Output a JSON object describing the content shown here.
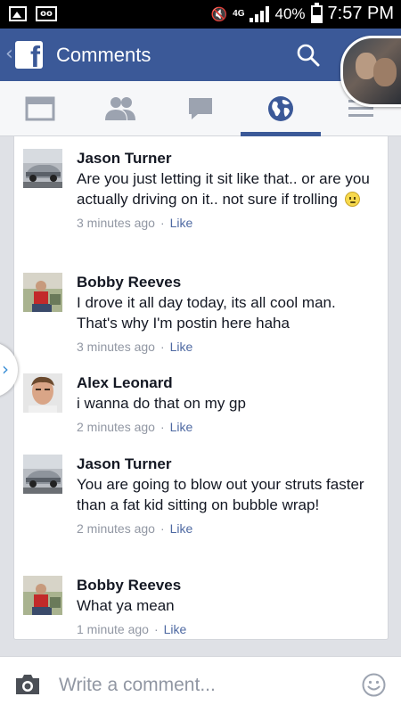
{
  "status_bar": {
    "network": "4G",
    "battery": "40%",
    "time": "7:57 PM"
  },
  "header": {
    "title": "Comments"
  },
  "tabs": [
    {
      "icon": "news-feed-icon",
      "active": false
    },
    {
      "icon": "friends-icon",
      "active": false
    },
    {
      "icon": "messages-icon",
      "active": false
    },
    {
      "icon": "globe-icon",
      "active": true
    },
    {
      "icon": "menu-icon",
      "active": false
    }
  ],
  "comments": [
    {
      "author": "Jason Turner",
      "text": "Are you just letting it sit like that.. or are you actually driving on it.. not sure if trolling",
      "has_emoji": true,
      "time": "3 minutes ago",
      "like_label": "Like"
    },
    {
      "author": "Bobby Reeves",
      "text": "I drove it all day today, its all cool man. That's why I'm postin here haha",
      "has_emoji": false,
      "time": "3 minutes ago",
      "like_label": "Like"
    },
    {
      "author": "Alex Leonard",
      "text": "i wanna do that on my gp",
      "has_emoji": false,
      "time": "2 minutes ago",
      "like_label": "Like"
    },
    {
      "author": "Jason Turner",
      "text": "You are going to blow out your struts faster than a fat kid sitting on bubble wrap!",
      "has_emoji": false,
      "time": "2 minutes ago",
      "like_label": "Like"
    },
    {
      "author": "Bobby Reeves",
      "text": "What ya mean",
      "has_emoji": false,
      "time": "1 minute ago",
      "like_label": "Like"
    }
  ],
  "meta_separator": "·",
  "composer": {
    "placeholder": "Write a comment..."
  },
  "colors": {
    "brand": "#3b5998",
    "like": "#4e69a2",
    "meta": "#9197a3"
  }
}
